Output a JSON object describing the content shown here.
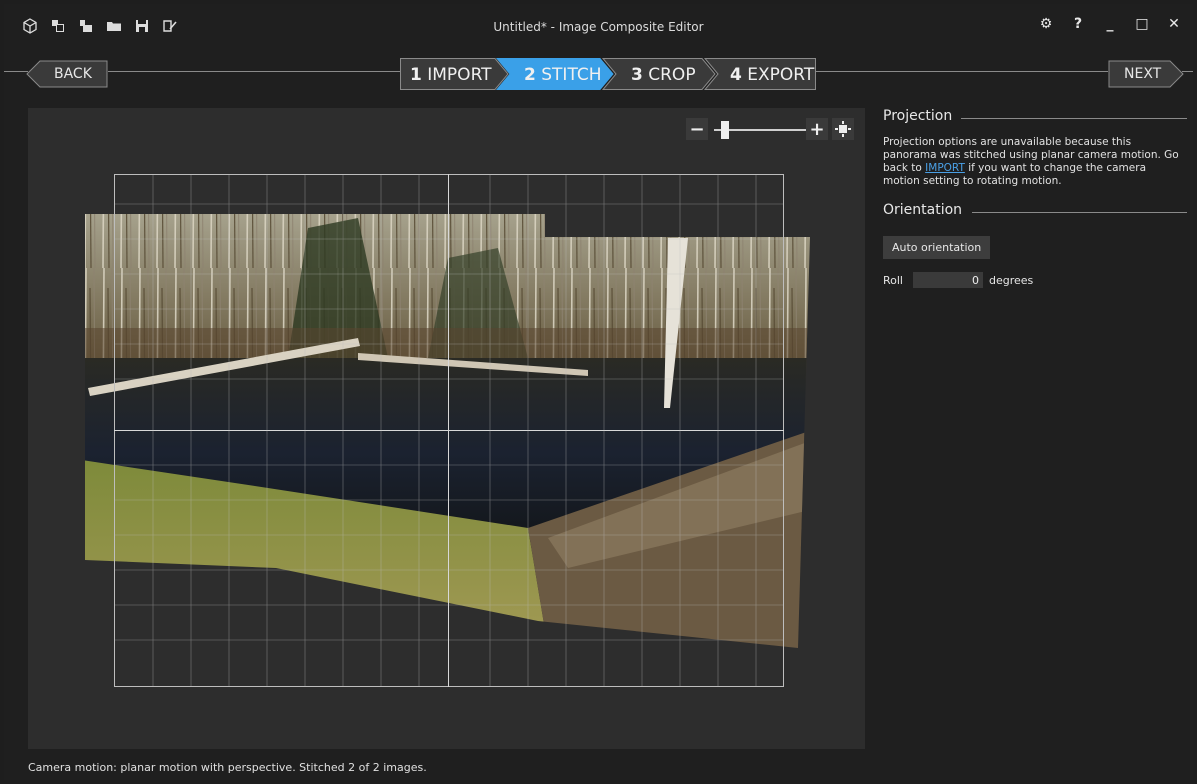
{
  "window": {
    "title": "Untitled* - Image Composite Editor",
    "toolbar_icons": [
      "ice-logo-icon",
      "new-panorama-icon",
      "open-icon",
      "folder-icon",
      "save-icon",
      "save-as-icon"
    ],
    "controls": {
      "settings": "⚙",
      "help": "?",
      "minimize": "_",
      "maximize": "□",
      "close": "✕"
    }
  },
  "nav": {
    "back_label": "BACK",
    "next_label": "NEXT",
    "steps": [
      {
        "num": "1",
        "label": "IMPORT",
        "active": false
      },
      {
        "num": "2",
        "label": "STITCH",
        "active": true
      },
      {
        "num": "3",
        "label": "CROP",
        "active": false
      },
      {
        "num": "4",
        "label": "EXPORT",
        "active": false
      }
    ],
    "active_color": "#3aa0e8"
  },
  "zoom": {
    "minus": "−",
    "plus": "+"
  },
  "panel": {
    "projection_title": "Projection",
    "projection_desc_before": "Projection options are unavailable because this panorama was stitched using planar camera motion. Go back to ",
    "projection_link": "IMPORT",
    "projection_desc_after": " if you want to change the camera motion setting to rotating motion.",
    "orientation_title": "Orientation",
    "auto_orientation_label": "Auto orientation",
    "roll_label": "Roll",
    "roll_value": "0",
    "roll_unit": "degrees"
  },
  "status": "Camera motion: planar motion with perspective. Stitched 2 of 2 images."
}
